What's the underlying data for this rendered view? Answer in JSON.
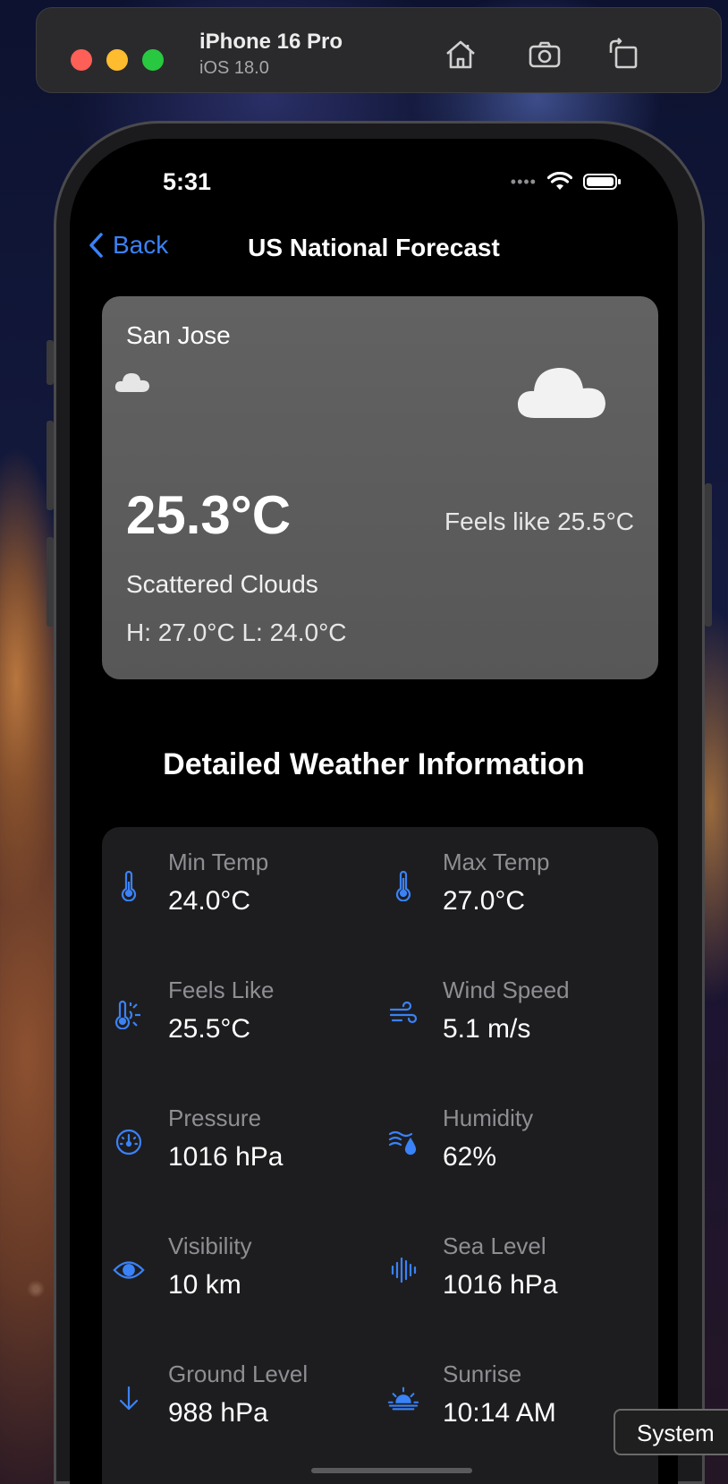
{
  "simulator": {
    "device_name": "iPhone 16 Pro",
    "os_version": "iOS 18.0"
  },
  "status_bar": {
    "time": "5:31"
  },
  "nav": {
    "back_label": "Back",
    "title": "US National Forecast"
  },
  "current": {
    "city": "San Jose",
    "temperature": "25.3°C",
    "feels_like": "Feels like 25.5°C",
    "description": "Scattered Clouds",
    "high_low": "H: 27.0°C  L: 24.0°C",
    "icon": "cloud-icon"
  },
  "details": {
    "title": "Detailed Weather Information",
    "items": [
      {
        "label": "Min Temp",
        "value": "24.0°C",
        "icon": "thermometer-icon"
      },
      {
        "label": "Max Temp",
        "value": "27.0°C",
        "icon": "thermometer-icon"
      },
      {
        "label": "Feels Like",
        "value": "25.5°C",
        "icon": "thermometer-sun-icon"
      },
      {
        "label": "Wind Speed",
        "value": "5.1 m/s",
        "icon": "wind-icon"
      },
      {
        "label": "Pressure",
        "value": "1016 hPa",
        "icon": "gauge-icon"
      },
      {
        "label": "Humidity",
        "value": "62%",
        "icon": "humidity-icon"
      },
      {
        "label": "Visibility",
        "value": "10 km",
        "icon": "eye-icon"
      },
      {
        "label": "Sea Level",
        "value": "1016 hPa",
        "icon": "waveform-icon"
      },
      {
        "label": "Ground Level",
        "value": "988 hPa",
        "icon": "arrow-down-icon"
      },
      {
        "label": "Sunrise",
        "value": "10:14 AM",
        "icon": "sunrise-icon"
      }
    ]
  },
  "overlay": {
    "system_label": "System"
  },
  "colors": {
    "accent": "#3a82f7",
    "card_top": "#626262",
    "detail_card": "#1d1d1f"
  }
}
